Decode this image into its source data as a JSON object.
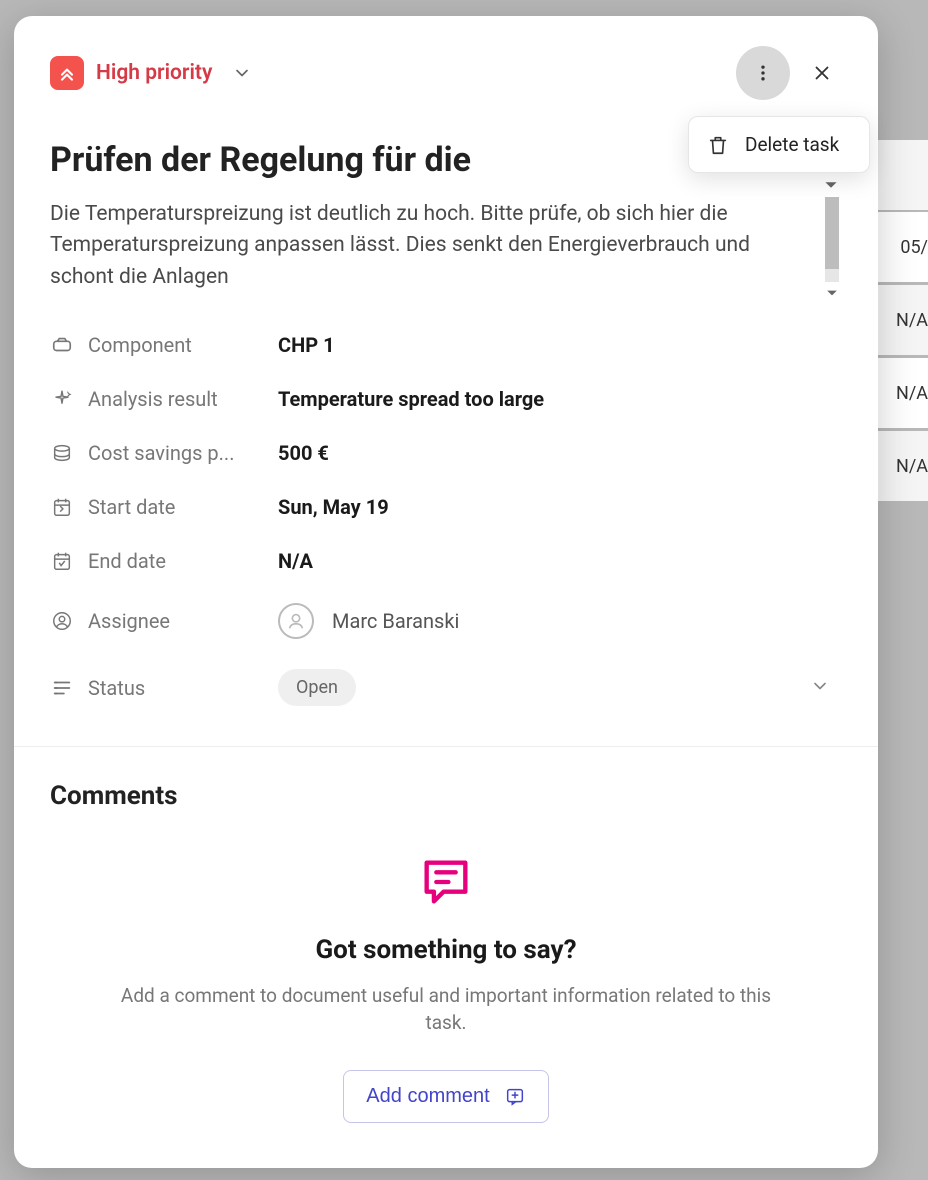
{
  "priority": {
    "label": "High priority"
  },
  "menu": {
    "delete_label": "Delete task"
  },
  "task": {
    "title": "Prüfen der Regelung für die",
    "description": "Die Temperaturspreizung ist deutlich zu hoch. Bitte prüfe, ob sich hier die Temperaturspreizung anpassen lässt. Dies senkt den Energieverbrauch und schont die Anlagen"
  },
  "fields": {
    "component": {
      "label": "Component",
      "value": "CHP 1"
    },
    "analysis_result": {
      "label": "Analysis result",
      "value": "Temperature spread too large"
    },
    "cost_savings": {
      "label": "Cost savings p...",
      "value": "500 €"
    },
    "start_date": {
      "label": "Start date",
      "value": "Sun, May 19"
    },
    "end_date": {
      "label": "End date",
      "value": "N/A"
    },
    "assignee": {
      "label": "Assignee",
      "value": "Marc Baranski"
    },
    "status": {
      "label": "Status",
      "value": "Open"
    }
  },
  "comments": {
    "heading": "Comments",
    "empty_title": "Got something to say?",
    "empty_sub": "Add a comment to document useful and important information related to this task.",
    "add_button": "Add comment"
  },
  "bg_rows": [
    "",
    "05/",
    "N/A",
    "N/A",
    "N/A"
  ]
}
